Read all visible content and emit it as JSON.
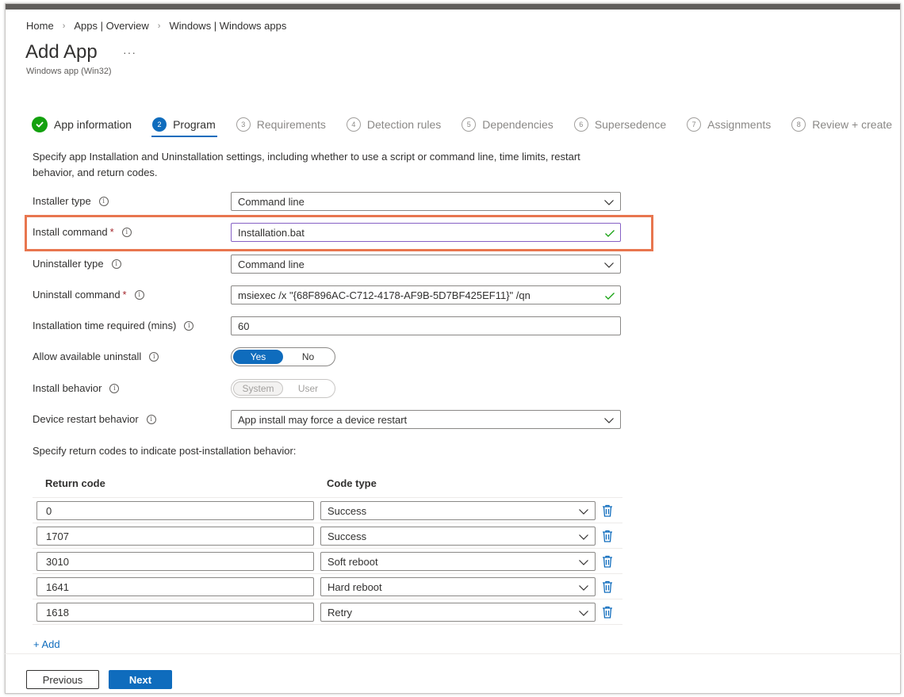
{
  "breadcrumb": [
    "Home",
    "Apps | Overview",
    "Windows | Windows apps"
  ],
  "page": {
    "title": "Add App",
    "more": "...",
    "subtitle": "Windows app (Win32)"
  },
  "steps": [
    {
      "num": "✓",
      "label": "App information",
      "state": "done"
    },
    {
      "num": "2",
      "label": "Program",
      "state": "active"
    },
    {
      "num": "3",
      "label": "Requirements",
      "state": "pending"
    },
    {
      "num": "4",
      "label": "Detection rules",
      "state": "pending"
    },
    {
      "num": "5",
      "label": "Dependencies",
      "state": "pending"
    },
    {
      "num": "6",
      "label": "Supersedence",
      "state": "pending"
    },
    {
      "num": "7",
      "label": "Assignments",
      "state": "pending"
    },
    {
      "num": "8",
      "label": "Review + create",
      "state": "pending"
    }
  ],
  "description": "Specify app Installation and Uninstallation settings, including whether to use a script or command line, time limits, restart behavior, and return codes.",
  "form": {
    "installer_type": {
      "label": "Installer type",
      "value": "Command line"
    },
    "install_command": {
      "label": "Install command",
      "required": "*",
      "value": "Installation.bat"
    },
    "uninstaller_type": {
      "label": "Uninstaller type",
      "value": "Command line"
    },
    "uninstall_command": {
      "label": "Uninstall command",
      "required": "*",
      "value": "msiexec /x \"{68F896AC-C712-4178-AF9B-5D7BF425EF11}\" /qn"
    },
    "install_time": {
      "label": "Installation time required (mins)",
      "value": "60"
    },
    "allow_uninstall": {
      "label": "Allow available uninstall",
      "yes": "Yes",
      "no": "No",
      "selected": "Yes"
    },
    "install_behavior": {
      "label": "Install behavior",
      "system": "System",
      "user": "User",
      "selected": "System"
    },
    "device_restart": {
      "label": "Device restart behavior",
      "value": "App install may force a device restart"
    }
  },
  "return_codes": {
    "intro": "Specify return codes to indicate post-installation behavior:",
    "col_code": "Return code",
    "col_type": "Code type",
    "rows": [
      {
        "code": "0",
        "type": "Success"
      },
      {
        "code": "1707",
        "type": "Success"
      },
      {
        "code": "3010",
        "type": "Soft reboot"
      },
      {
        "code": "1641",
        "type": "Hard reboot"
      },
      {
        "code": "1618",
        "type": "Retry"
      }
    ],
    "add_label": "+ Add"
  },
  "footer": {
    "previous": "Previous",
    "next": "Next"
  },
  "colors": {
    "accent": "#0f6cbd",
    "success": "#13a10e",
    "highlight": "#e8764f",
    "required": "#a4262c"
  },
  "icons": [
    "chevron-right-icon",
    "checkmark-circle-icon",
    "info-icon",
    "chevron-down-icon",
    "checkmark-icon",
    "trash-icon"
  ]
}
